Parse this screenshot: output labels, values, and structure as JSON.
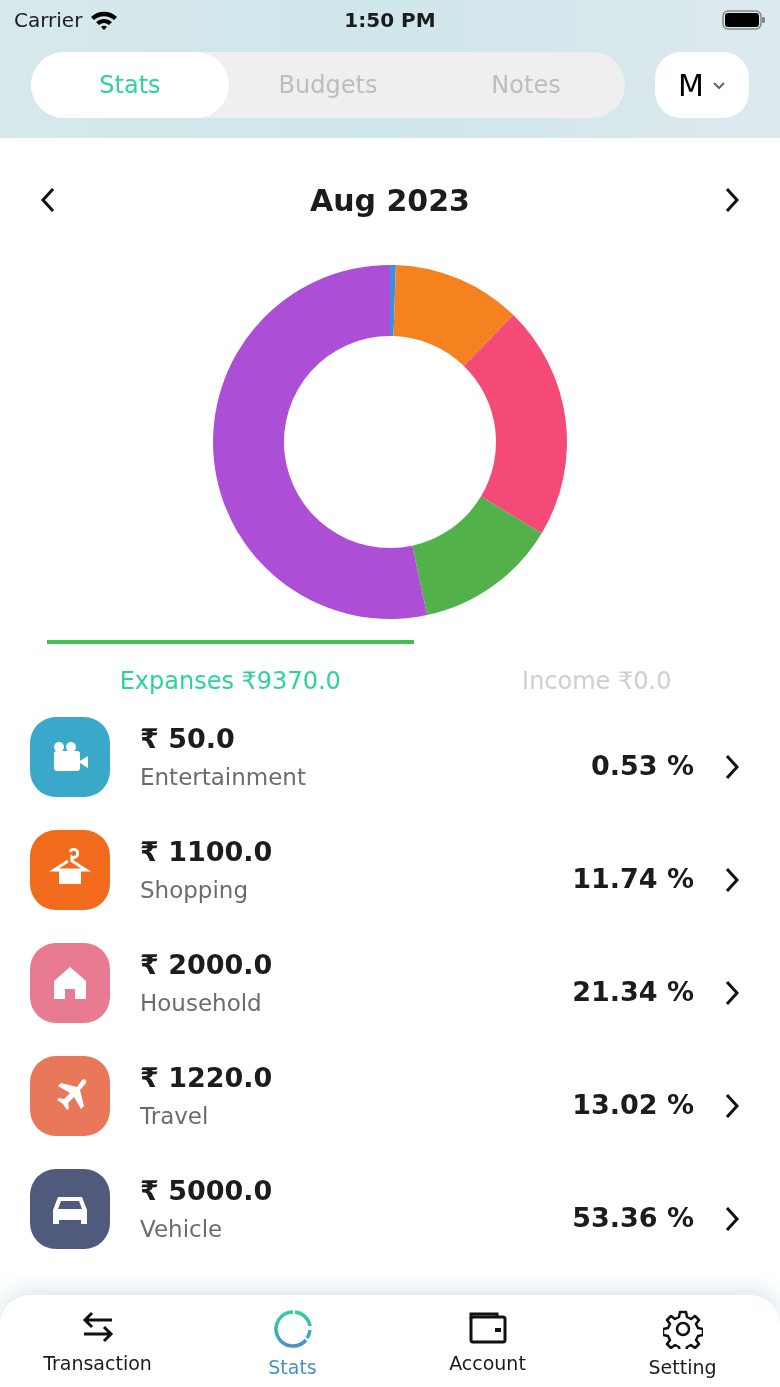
{
  "status_bar": {
    "carrier": "Carrier",
    "time": "1:50 PM"
  },
  "segments": [
    {
      "label": "Stats",
      "selected": true
    },
    {
      "label": "Budgets",
      "selected": false
    },
    {
      "label": "Notes",
      "selected": false
    }
  ],
  "period_select": {
    "value": "M"
  },
  "month": {
    "label": "Aug 2023"
  },
  "chart_data": {
    "type": "donut",
    "values": [
      0.53,
      11.74,
      21.34,
      13.02,
      53.36
    ],
    "colors": [
      "#3f8fe0",
      "#f5821f",
      "#f44a78",
      "#52b14a",
      "#ad4fd6"
    ]
  },
  "type_tabs": [
    {
      "label": "Expanses ₹9370.0",
      "selected": true
    },
    {
      "label": "Income ₹0.0",
      "selected": false
    }
  ],
  "categories": [
    {
      "amount": "₹ 50.0",
      "name": "Entertainment",
      "percent": "0.53 %",
      "color": "#3aa9c9"
    },
    {
      "amount": "₹ 1100.0",
      "name": "Shopping",
      "percent": "11.74 %",
      "color": "#f26a1b"
    },
    {
      "amount": "₹ 2000.0",
      "name": "Household",
      "percent": "21.34 %",
      "color": "#e87a92"
    },
    {
      "amount": "₹ 1220.0",
      "name": "Travel",
      "percent": "13.02 %",
      "color": "#e9785a"
    },
    {
      "amount": "₹ 5000.0",
      "name": "Vehicle",
      "percent": "53.36 %",
      "color": "#4f5a7c"
    }
  ],
  "bottom_nav": [
    {
      "label": "Transaction",
      "selected": false
    },
    {
      "label": "Stats",
      "selected": true
    },
    {
      "label": "Account",
      "selected": false
    },
    {
      "label": "Setting",
      "selected": false
    }
  ]
}
